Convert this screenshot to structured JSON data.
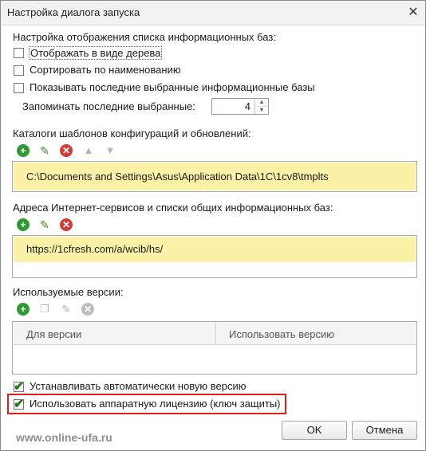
{
  "window": {
    "title": "Настройка диалога запуска",
    "close_glyph": "✕"
  },
  "display": {
    "heading": "Настройка отображения списка информационных баз:",
    "tree_view": {
      "label": "Отображать в виде дерева",
      "checked": false
    },
    "sort_by_name": {
      "label": "Сортировать по наименованию",
      "checked": false
    },
    "show_recent": {
      "label": "Показывать последние выбранные информационные базы",
      "checked": false
    },
    "remember_label": "Запоминать последние выбранные:",
    "remember_value": "4"
  },
  "templates": {
    "heading": "Каталоги шаблонов конфигураций и обновлений:",
    "items": [
      "C:\\Documents and Settings\\Asus\\Application Data\\1C\\1cv8\\tmplts"
    ]
  },
  "internet": {
    "heading": "Адреса Интернет-сервисов и списки общих информационных баз:",
    "items": [
      "https://1cfresh.com/a/wcib/hs/"
    ]
  },
  "versions": {
    "heading": "Используемые версии:",
    "columns": [
      "Для версии",
      "Использовать версию"
    ]
  },
  "options": {
    "auto_install": {
      "label": "Устанавливать автоматически новую версию",
      "checked": true
    },
    "hardware_license": {
      "label": "Использовать аппаратную лицензию (ключ защиты)",
      "checked": true
    }
  },
  "buttons": {
    "ok": "OK",
    "cancel": "Отмена"
  },
  "watermark": "www.online-ufa.ru",
  "icons": {
    "add": "+",
    "edit": "✎",
    "delete": "✕",
    "up": "▲",
    "down": "▼",
    "copy": "❐",
    "check": "✔"
  },
  "colors": {
    "selection": "#fbf2a7",
    "highlight_border": "#e31c1c",
    "check": "#1f7a1f"
  }
}
